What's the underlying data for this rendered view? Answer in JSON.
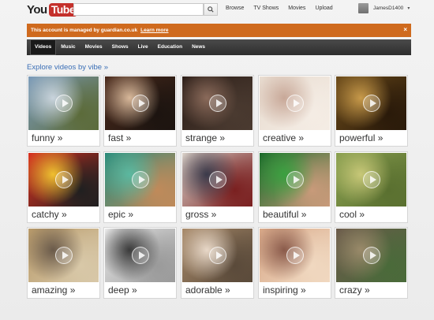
{
  "header": {
    "logo_you": "You",
    "logo_tube": "Tube",
    "search_placeholder": "",
    "nav": [
      "Browse",
      "TV Shows",
      "Movies",
      "Upload"
    ],
    "username": "JamesD1400"
  },
  "banner": {
    "text": "This account is managed by guardian.co.uk",
    "link": "Learn more",
    "close": "×",
    "color": "#cf6a1e"
  },
  "categories": [
    "Videos",
    "Music",
    "Movies",
    "Shows",
    "Live",
    "Education",
    "News"
  ],
  "section_title": "Explore videos by vibe »",
  "tiles": [
    {
      "label": "funny »",
      "colors": [
        "#7a9ab8",
        "#c9d4dd",
        "#5c6b3a"
      ]
    },
    {
      "label": "fast »",
      "colors": [
        "#4a2a1c",
        "#d8b89a",
        "#1c1410"
      ]
    },
    {
      "label": "strange »",
      "colors": [
        "#2c1e18",
        "#8a6a5a",
        "#4a3a30"
      ]
    },
    {
      "label": "creative »",
      "colors": [
        "#e8dcd0",
        "#c8a898",
        "#f4ece4"
      ]
    },
    {
      "label": "powerful »",
      "colors": [
        "#6a4a1a",
        "#c89a4a",
        "#2a1a0a"
      ]
    },
    {
      "label": "catchy »",
      "colors": [
        "#d83020",
        "#f0c030",
        "#202020"
      ]
    },
    {
      "label": "epic »",
      "colors": [
        "#2a8a7a",
        "#5ab8a0",
        "#c08a5a"
      ]
    },
    {
      "label": "gross »",
      "colors": [
        "#d8d0c8",
        "#3a3a4a",
        "#7a2020"
      ]
    },
    {
      "label": "beautiful »",
      "colors": [
        "#1a6a2a",
        "#3aa040",
        "#c89a7a"
      ]
    },
    {
      "label": "cool »",
      "colors": [
        "#8aa050",
        "#c8c878",
        "#5a7030"
      ]
    },
    {
      "label": "amazing »",
      "colors": [
        "#b89a6a",
        "#6a5a4a",
        "#d8c8a8"
      ]
    },
    {
      "label": "deep »",
      "colors": [
        "#e8e8e8",
        "#3a3a3a",
        "#9a9a9a"
      ]
    },
    {
      "label": "adorable »",
      "colors": [
        "#a88a6a",
        "#e8d8c8",
        "#5a4a3a"
      ]
    },
    {
      "label": "inspiring »",
      "colors": [
        "#d8a888",
        "#8a5a4a",
        "#f0d8c0"
      ]
    },
    {
      "label": "crazy »",
      "colors": [
        "#6a5a4a",
        "#9a8a6a",
        "#4a6a3a"
      ]
    }
  ]
}
